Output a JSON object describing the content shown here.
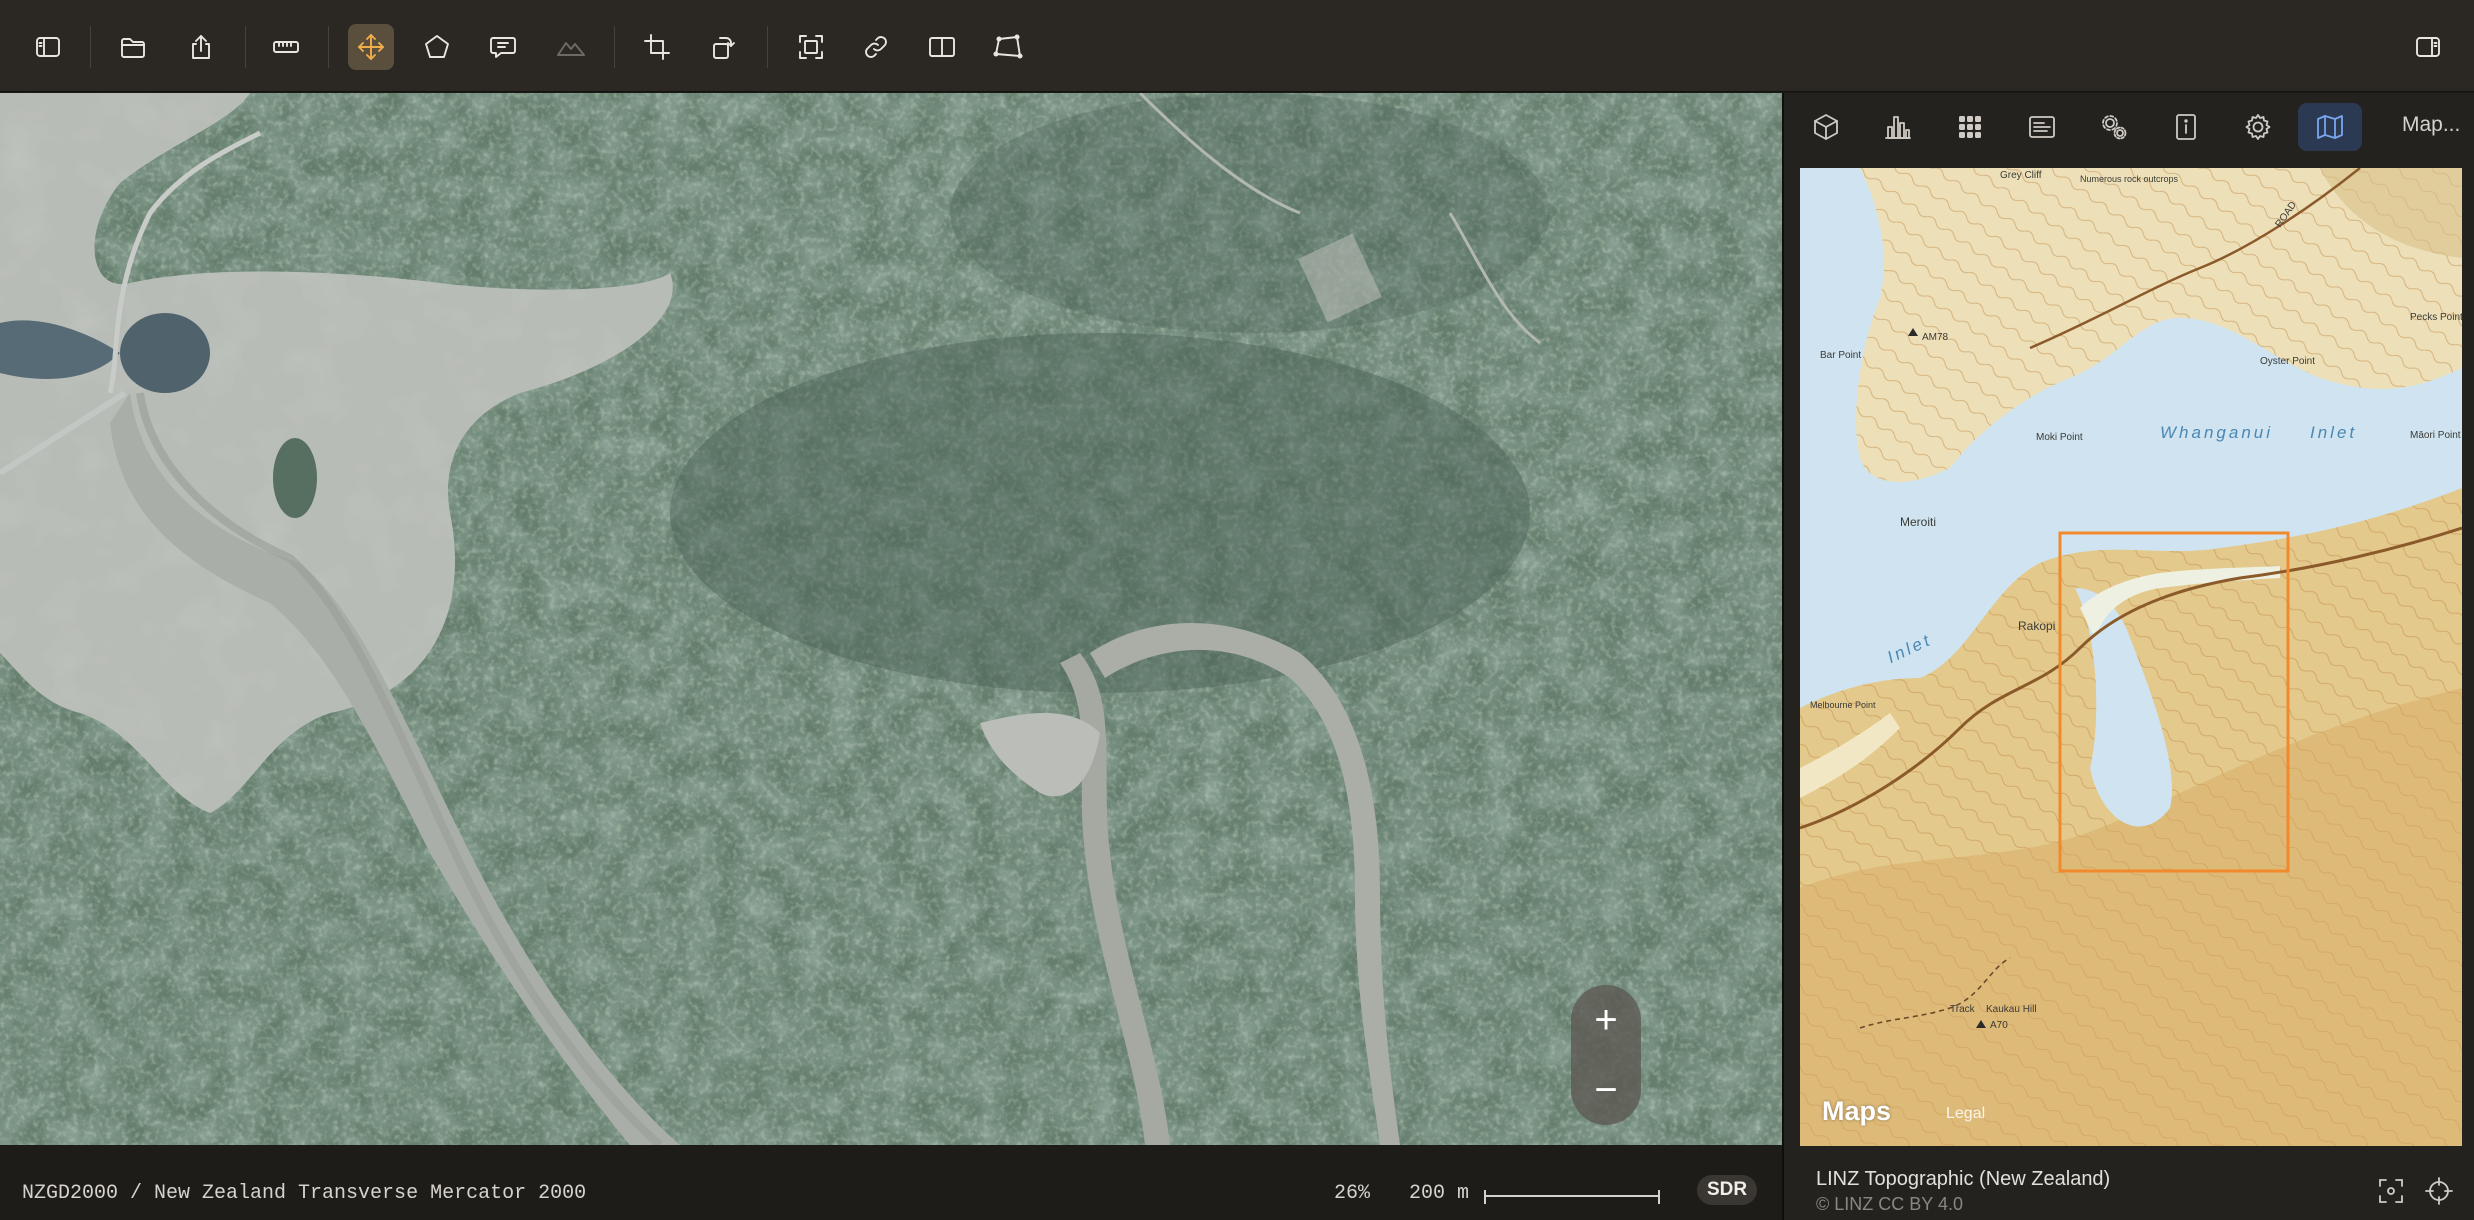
{
  "toolbar": {
    "buttons": [
      {
        "id": "toggle-sidebar",
        "icon": "sidebar-left-icon"
      },
      {
        "id": "open",
        "icon": "folder-icon"
      },
      {
        "id": "share",
        "icon": "share-icon"
      },
      {
        "id": "measure",
        "icon": "ruler-icon"
      },
      {
        "id": "pan",
        "icon": "move-arrows-icon",
        "active": true
      },
      {
        "id": "polygon",
        "icon": "polygon-icon"
      },
      {
        "id": "annotate",
        "icon": "speech-bubble-icon"
      },
      {
        "id": "terrain",
        "icon": "terrain-icon",
        "disabled": true
      },
      {
        "id": "crop",
        "icon": "crop-icon"
      },
      {
        "id": "rotate",
        "icon": "rotate-icon"
      },
      {
        "id": "fit",
        "icon": "fit-frame-icon"
      },
      {
        "id": "link",
        "icon": "link-icon"
      },
      {
        "id": "split",
        "icon": "split-view-icon"
      },
      {
        "id": "perspective",
        "icon": "perspective-icon"
      },
      {
        "id": "inspector",
        "icon": "sidebar-right-icon"
      }
    ]
  },
  "status": {
    "crs": "NZGD2000 / New Zealand Transverse Mercator 2000",
    "zoom": "26%",
    "scale": "200 m",
    "hdr_badge": "SDR"
  },
  "side_panel": {
    "tabs": [
      {
        "icon": "cube-icon"
      },
      {
        "icon": "histogram-icon"
      },
      {
        "icon": "grid-icon"
      },
      {
        "icon": "metadata-icon"
      },
      {
        "icon": "processing-gears-icon"
      },
      {
        "icon": "info-icon"
      },
      {
        "icon": "settings-icon"
      },
      {
        "icon": "map-icon",
        "active": true
      }
    ],
    "more_label": "Map...",
    "map": {
      "source": "LINZ Topographic (New Zealand)",
      "credit": "© LINZ CC BY 4.0",
      "logo": "Maps",
      "legal": "Legal",
      "zoom_in": "+",
      "zoom_out": "−",
      "labels": {
        "grey_cliff": "Grey Cliff",
        "numerous_rock": "Numerous rock outcrops",
        "am78": "AM78",
        "bar_point": "Bar Point",
        "oyster_point": "Oyster Point",
        "pecks_point": "Pecks Point",
        "whanganui": "Whanganui",
        "inlet": "Inlet",
        "inlet_left": "Inlet",
        "moki_point": "Moki Point",
        "maori_point": "Māori Point",
        "meroiti": "Meroiti",
        "rakopi": "Rakopi",
        "melbourne_point": "Melbourne Point",
        "track": "Track",
        "kaukau_hill": "Kaukau Hill",
        "a70": "A70",
        "road": "ROAD"
      }
    }
  },
  "colors": {
    "accent_active": "#f1ad4a",
    "map_tab_active": "#79a6ee",
    "viewport_box": "#f08a2c"
  }
}
